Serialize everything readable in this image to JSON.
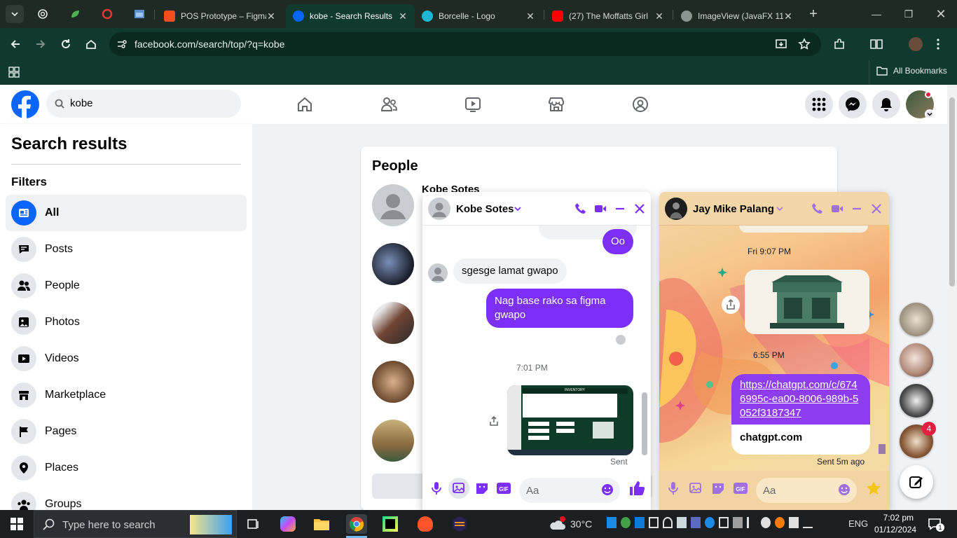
{
  "browser": {
    "tabs": [
      {
        "title": "POS Prototype – Figma",
        "icon": "figma-icon"
      },
      {
        "title": "kobe - Search Results",
        "icon": "facebook-icon",
        "active": true
      },
      {
        "title": "Borcelle - Logo",
        "icon": "canva-icon"
      },
      {
        "title": "(27) The Moffatts Girl",
        "icon": "youtube-icon"
      },
      {
        "title": "ImageView (JavaFX 11)",
        "icon": "globe-icon"
      }
    ],
    "url": "facebook.com/search/top/?q=kobe",
    "bookmarks_label": "All Bookmarks"
  },
  "facebook": {
    "search_value": "kobe",
    "left_panel": {
      "title": "Search results",
      "filters_label": "Filters",
      "filters": [
        {
          "label": "All",
          "icon": "all-feed-icon",
          "selected": true
        },
        {
          "label": "Posts",
          "icon": "posts-icon"
        },
        {
          "label": "People",
          "icon": "people-icon"
        },
        {
          "label": "Photos",
          "icon": "photos-icon"
        },
        {
          "label": "Videos",
          "icon": "videos-icon"
        },
        {
          "label": "Marketplace",
          "icon": "marketplace-icon"
        },
        {
          "label": "Pages",
          "icon": "pages-flag-icon"
        },
        {
          "label": "Places",
          "icon": "place-pin-icon"
        },
        {
          "label": "Groups",
          "icon": "groups-icon"
        }
      ]
    },
    "results": {
      "section_title": "People",
      "first_name": "Kobe Sotes"
    }
  },
  "chat1": {
    "name": "Kobe Sotes",
    "messages": {
      "m1": "Oo",
      "m2": "sgesge lamat gwapo",
      "m3": "Nag base rako sa figma gwapo",
      "time": "7:01 PM",
      "sent": "Sent",
      "image_title": "INVENTORY"
    },
    "input_placeholder": "Aa"
  },
  "chat2": {
    "name": "Jay Mike Palang",
    "time1": "Fri 9:07 PM",
    "time2": "6:55 PM",
    "link": "https://chatgpt.com/c/6746995c-ea00-8006-989b-5052f3187347",
    "link_domain": "chatgpt.com",
    "sent": "Sent 5m ago",
    "input_placeholder": "Aa"
  },
  "rail": {
    "badge": "4"
  },
  "taskbar": {
    "search_placeholder": "Type here to search",
    "weather": "30°C",
    "lang": "ENG",
    "time": "7:02 pm",
    "date": "01/12/2024",
    "notification_count": "1"
  },
  "colors": {
    "fb_blue": "#0866ff",
    "messenger_purple": "#7b2ff7",
    "chrome_green": "#113a2e"
  }
}
